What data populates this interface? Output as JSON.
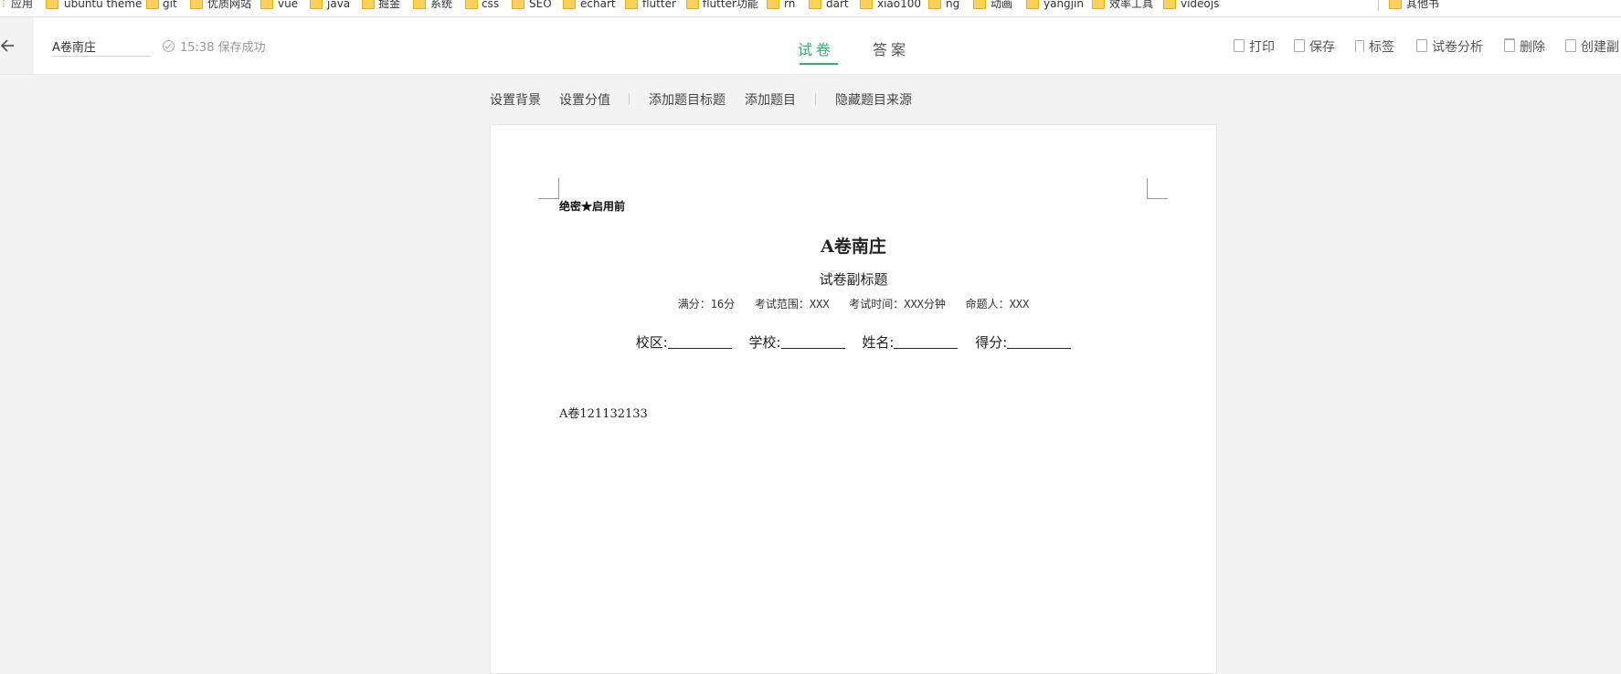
{
  "bookmarks": [
    {
      "label": "应用",
      "type": "apps"
    },
    {
      "label": "ubuntu theme",
      "type": "folder"
    },
    {
      "label": "git",
      "type": "folder"
    },
    {
      "label": "优质网站",
      "type": "folder"
    },
    {
      "label": "vue",
      "type": "folder"
    },
    {
      "label": "java",
      "type": "folder"
    },
    {
      "label": "掘金",
      "type": "folder"
    },
    {
      "label": "系统",
      "type": "folder"
    },
    {
      "label": "css",
      "type": "folder"
    },
    {
      "label": "SEO",
      "type": "folder"
    },
    {
      "label": "echart",
      "type": "folder"
    },
    {
      "label": "flutter",
      "type": "folder"
    },
    {
      "label": "flutter功能",
      "type": "folder"
    },
    {
      "label": "rn",
      "type": "folder"
    },
    {
      "label": "dart",
      "type": "folder"
    },
    {
      "label": "xiao100",
      "type": "folder"
    },
    {
      "label": "ng",
      "type": "folder"
    },
    {
      "label": "动画",
      "type": "folder"
    },
    {
      "label": "yangjin",
      "type": "folder"
    },
    {
      "label": "效率工具",
      "type": "folder"
    },
    {
      "label": "videojs",
      "type": "folder"
    },
    {
      "label": "其他书",
      "type": "folder"
    }
  ],
  "header": {
    "title_value": "A卷南庄",
    "save_status": "15:38 保存成功",
    "tabs": [
      {
        "label": "试卷",
        "active": true
      },
      {
        "label": "答案",
        "active": false
      }
    ],
    "tools": [
      {
        "label": "打印",
        "icon": "print-icon"
      },
      {
        "label": "保存",
        "icon": "save-icon"
      },
      {
        "label": "标签",
        "icon": "bookmark-icon"
      },
      {
        "label": "试卷分析",
        "icon": "copy-icon"
      },
      {
        "label": "删除",
        "icon": "trash-icon"
      },
      {
        "label": "创建副",
        "icon": "copy-icon"
      }
    ]
  },
  "toolbar": {
    "set_background": "设置背景",
    "set_score": "设置分值",
    "add_section_title": "添加题目标题",
    "add_question": "添加题目",
    "hide_source": "隐藏题目来源"
  },
  "paper": {
    "secret": "绝密★启用前",
    "title": "A卷南庄",
    "subtitle": "试卷副标题",
    "info": "满分：16分   考试范围：XXX   考试时间：XXX分钟   命题人：XXX",
    "fields": [
      "校区:",
      "学校:",
      "姓名:",
      "得分:"
    ],
    "question": "A卷121132133"
  },
  "colors": {
    "accent": "#2ab26e",
    "folder": "#ffd15c"
  }
}
